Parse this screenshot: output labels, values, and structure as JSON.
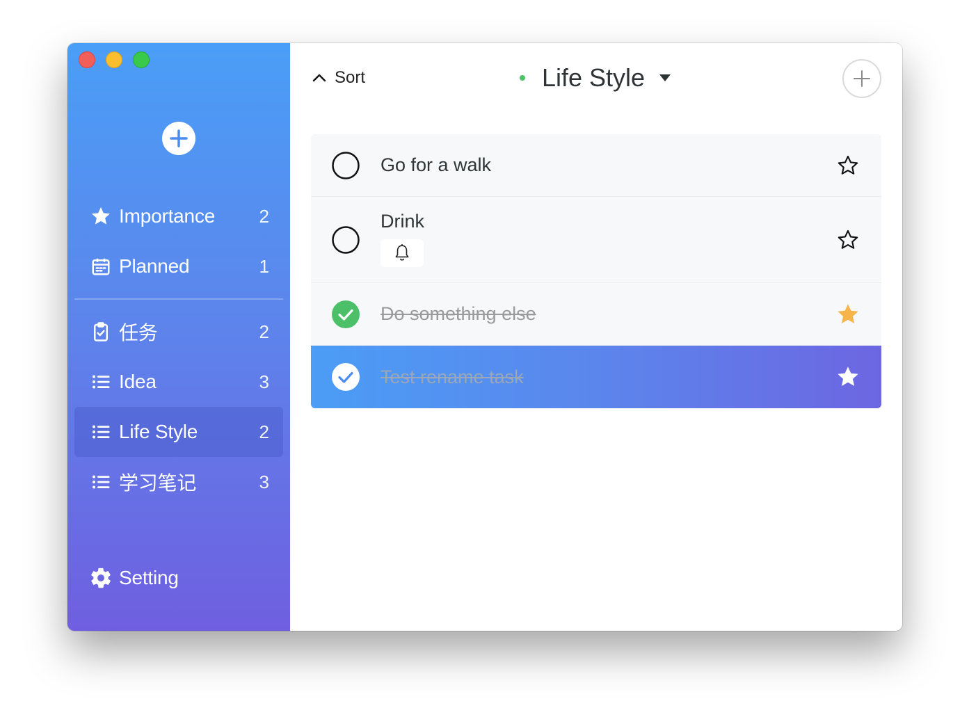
{
  "colors": {
    "accent": "#4a9ef7",
    "accent_end": "#6f5fe0",
    "done_green": "#4cc069",
    "star_orange": "#f6b44b",
    "list_dot": "#4cc069"
  },
  "sidebar": {
    "new_list_icon": "plus-circle-icon",
    "smart_lists": [
      {
        "label": "Importance",
        "count": "2",
        "icon": "star-icon"
      },
      {
        "label": "Planned",
        "count": "1",
        "icon": "calendar-icon"
      }
    ],
    "lists": [
      {
        "label": "任务",
        "count": "2",
        "icon": "clipboard-check-icon"
      },
      {
        "label": "Idea",
        "count": "3",
        "icon": "list-icon"
      },
      {
        "label": "Life Style",
        "count": "2",
        "icon": "list-icon",
        "active": true
      },
      {
        "label": "学习笔记",
        "count": "3",
        "icon": "list-icon"
      }
    ],
    "setting_label": "Setting"
  },
  "header": {
    "sort_label": "Sort",
    "list_title": "Life Style"
  },
  "tasks": [
    {
      "name": "Go for a walk",
      "done": false,
      "starred": false
    },
    {
      "name": "Drink",
      "done": false,
      "starred": false,
      "has_reminder": true
    },
    {
      "name": "Do something else",
      "done": true,
      "starred": true
    },
    {
      "name": "Test rename task",
      "done": true,
      "starred": true,
      "selected": true
    }
  ]
}
